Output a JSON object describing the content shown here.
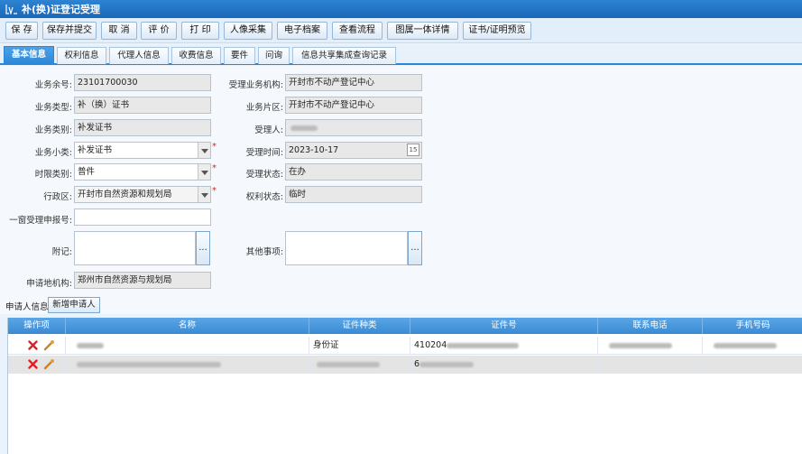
{
  "window": {
    "title": "补(换)证登记受理"
  },
  "toolbar": {
    "save": "保 存",
    "save_submit": "保存并提交",
    "cancel": "取 消",
    "evaluate": "评 价",
    "print": "打 印",
    "portrait": "人像采集",
    "e_archive": "电子档案",
    "view_flow": "查看流程",
    "integrated_detail": "图属一体详情",
    "cert_preview": "证书/证明预览"
  },
  "tabs": [
    "基本信息",
    "权利信息",
    "代理人信息",
    "收费信息",
    "要件",
    "问询",
    "信息共享集成查询记录"
  ],
  "form": {
    "business_no_label": "业务余号:",
    "business_no": "23101700030",
    "accept_org_label": "受理业务机构:",
    "accept_org": "开封市不动产登记中心",
    "business_type_label": "业务类型:",
    "business_type": "补（换）证书",
    "business_area_label": "业务片区:",
    "business_area": "开封市不动产登记中心",
    "business_category_label": "业务类别:",
    "business_category": "补发证书",
    "acceptor_label": "受理人:",
    "business_subclass_label": "业务小类:",
    "business_subclass": "补发证书",
    "accept_time_label": "受理时间:",
    "accept_time": "2023-10-17",
    "calendar_day": "15",
    "time_limit_label": "时限类别:",
    "time_limit": "普件",
    "accept_status_label": "受理状态:",
    "accept_status": "在办",
    "region_label": "行政区:",
    "region": "开封市自然资源和规划局",
    "right_status_label": "权利状态:",
    "right_status": "临时",
    "onewindow_label": "一窗受理申报号:",
    "onewindow": "",
    "remark_label": "附记:",
    "other_label": "其他事项:",
    "dots": "...",
    "apply_org_label": "申请地机构:",
    "apply_org": "郑州市自然资源与规划局",
    "required_mark": "*"
  },
  "applicant": {
    "label": "申请人信息",
    "add_button": "新增申请人"
  },
  "grid": {
    "columns": [
      "操作项",
      "名称",
      "证件种类",
      "证件号",
      "联系电话",
      "手机号码"
    ],
    "rows": [
      {
        "cert_type": "身份证",
        "cert_no_prefix": "410204"
      },
      {
        "cert_type": "",
        "cert_no_prefix": "6"
      }
    ]
  }
}
